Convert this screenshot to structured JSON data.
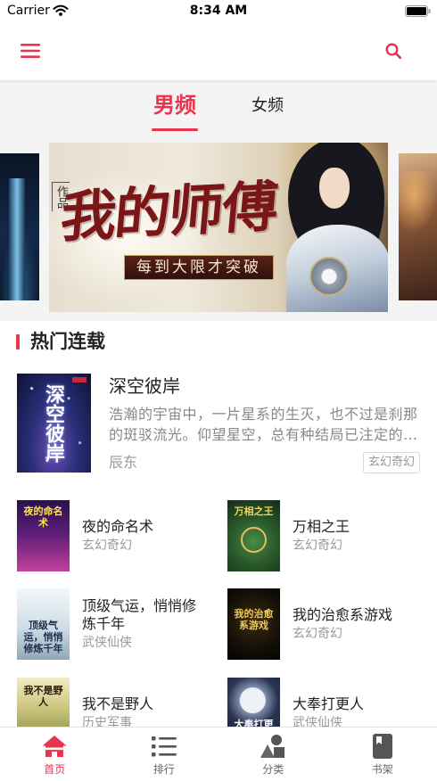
{
  "status_bar": {
    "carrier": "Carrier",
    "time": "8:34 AM"
  },
  "nav": {
    "menu_icon": "menu-icon",
    "search_icon": "search-icon"
  },
  "theme": {
    "accent": "#e8344e"
  },
  "channel_tabs": [
    {
      "label": "男频",
      "active": true
    },
    {
      "label": "女频",
      "active": false
    }
  ],
  "banner": {
    "tag": "作品",
    "title": "我的师傅",
    "subtitle": "每到大限才突破"
  },
  "section": {
    "title": "热门连载"
  },
  "featured_book": {
    "title": "深空彼岸",
    "description": "浩瀚的宇宙中，一片星系的生灭，也不过是刹那的斑驳流光。仰望星空，总有种结局已注定的…",
    "author": "辰东",
    "category": "玄幻奇幻"
  },
  "books": [
    {
      "title": "夜的命名术",
      "category": "玄幻奇幻"
    },
    {
      "title": "万相之王",
      "category": "玄幻奇幻"
    },
    {
      "title": "顶级气运，悄悄修炼千年",
      "category": "武侠仙侠"
    },
    {
      "title": "我的治愈系游戏",
      "category": "玄幻奇幻"
    },
    {
      "title": "我不是野人",
      "category": "历史军事"
    },
    {
      "title": "大奉打更人",
      "category": "武侠仙侠"
    }
  ],
  "tab_bar": [
    {
      "label": "首页",
      "icon": "home-icon",
      "active": true
    },
    {
      "label": "排行",
      "icon": "list-icon",
      "active": false
    },
    {
      "label": "分类",
      "icon": "category-icon",
      "active": false
    },
    {
      "label": "书架",
      "icon": "bookshelf-icon",
      "active": false
    }
  ]
}
